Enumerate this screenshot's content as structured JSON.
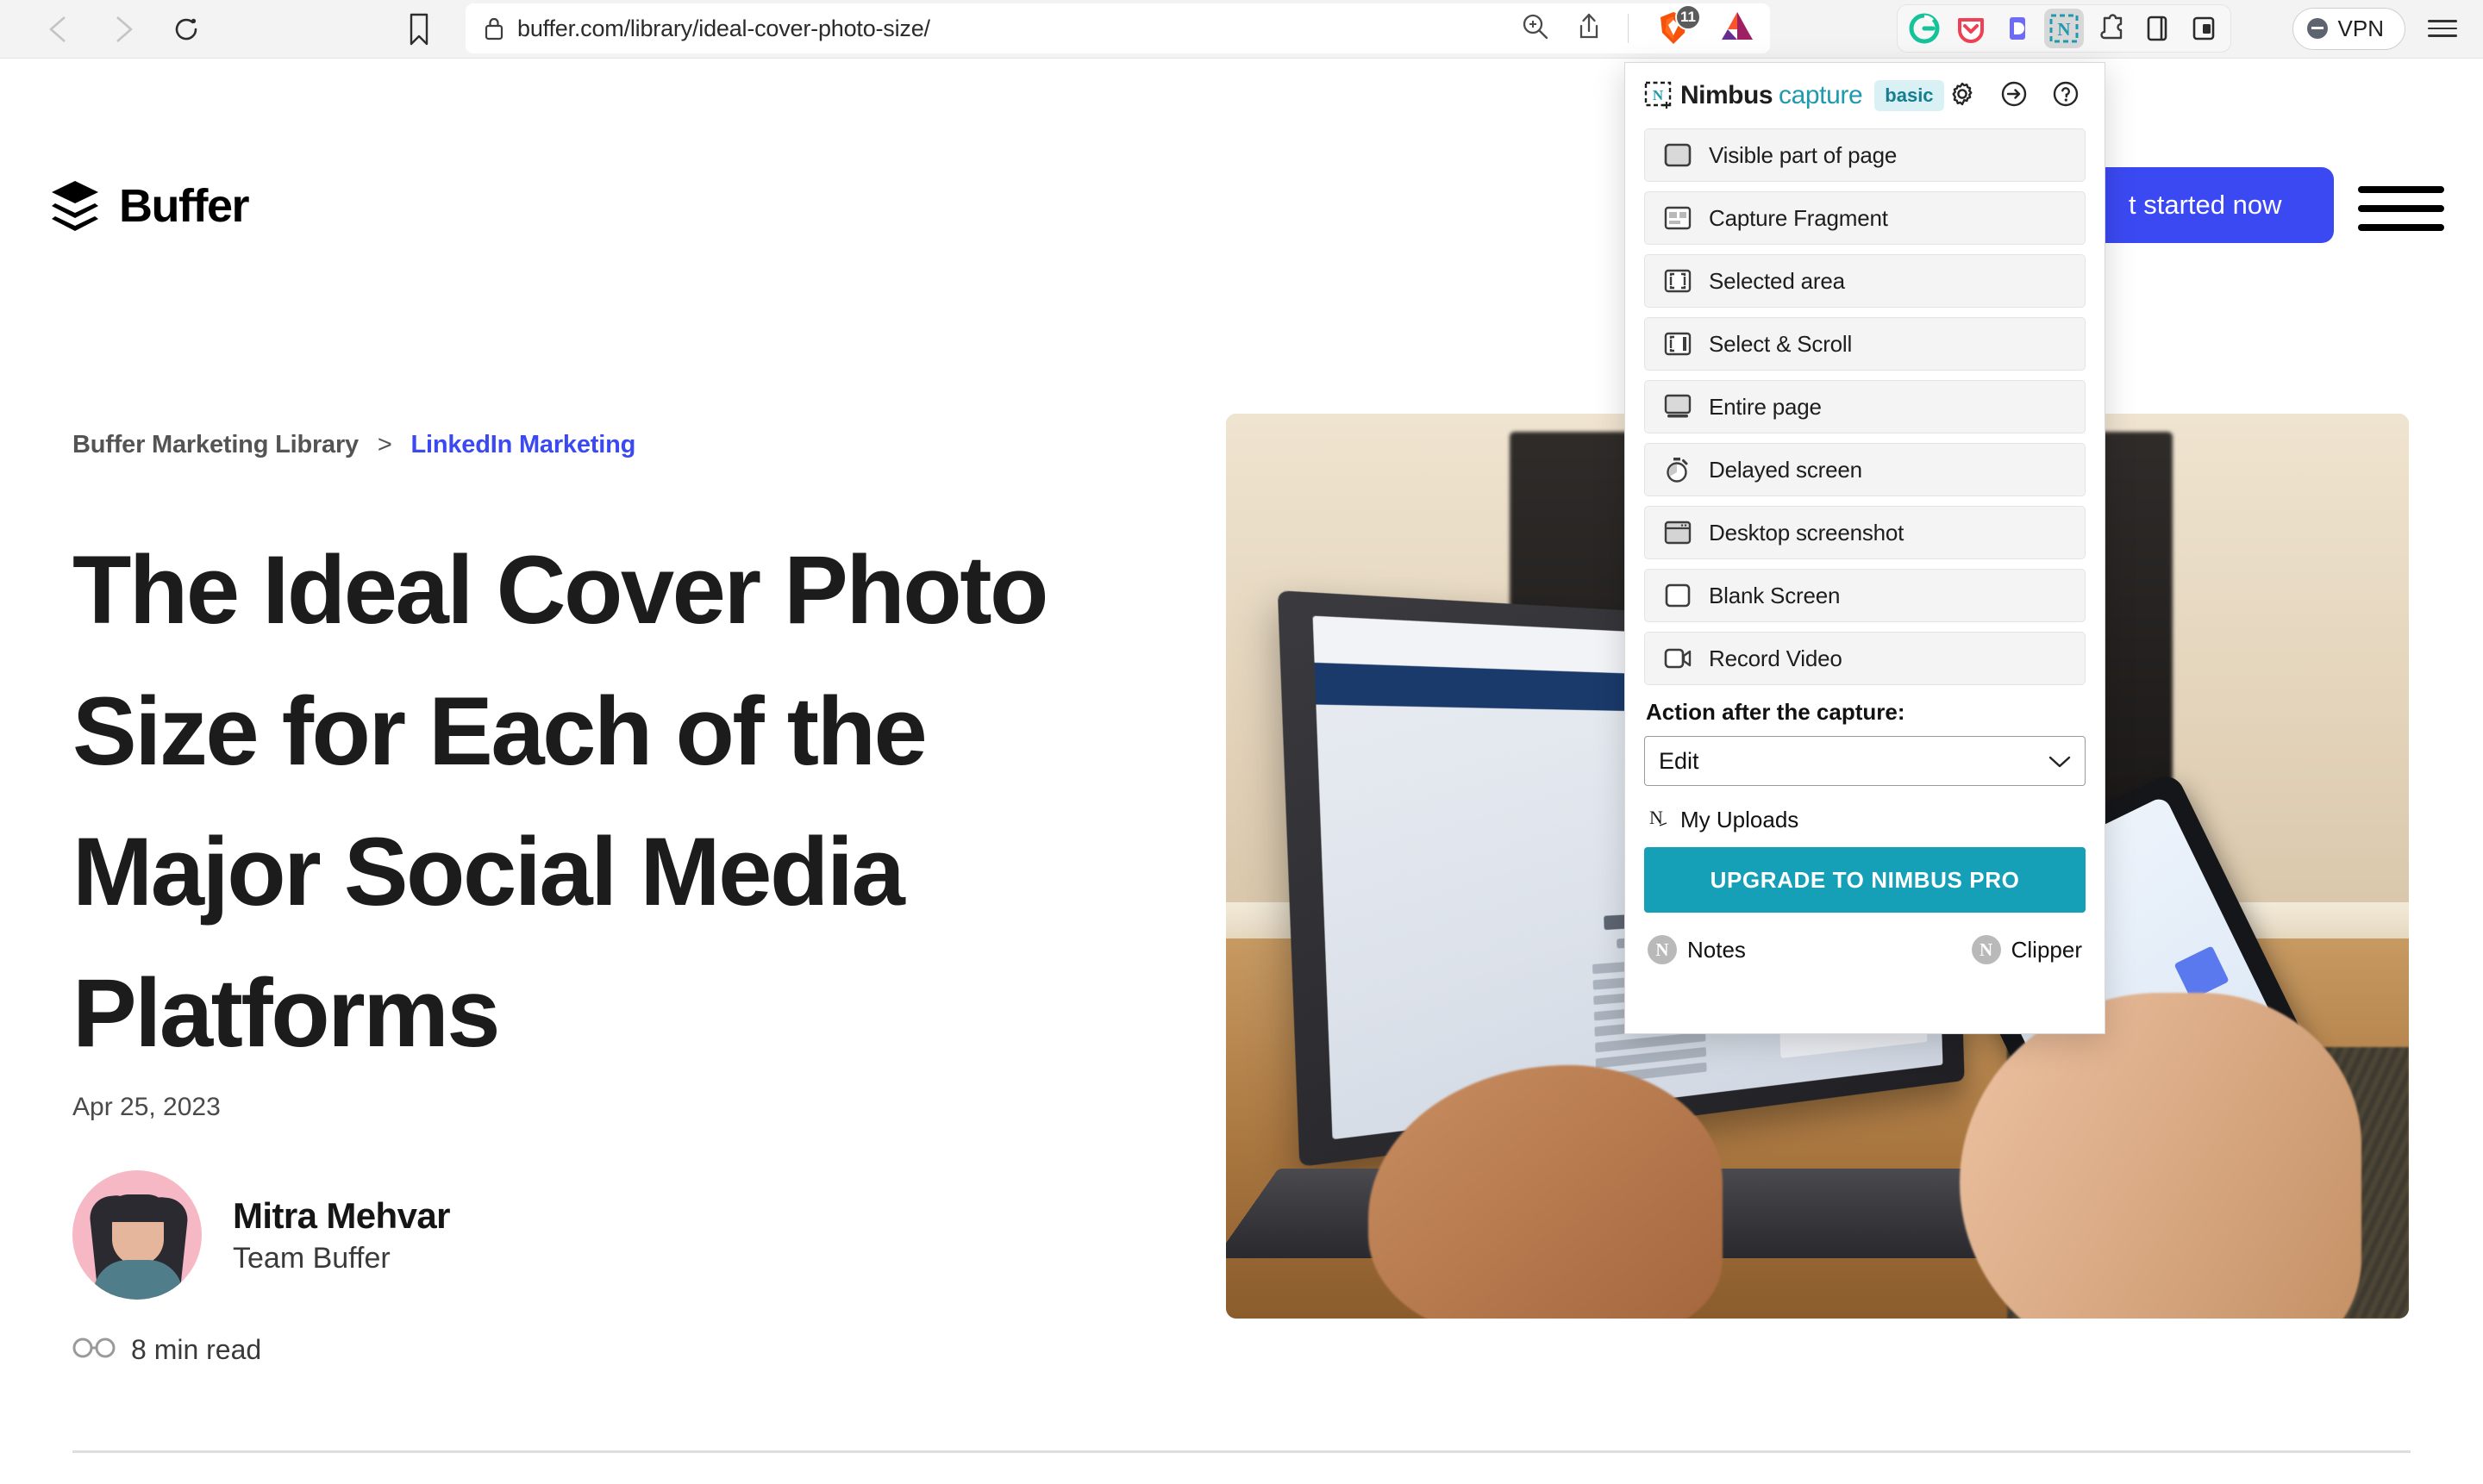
{
  "browser": {
    "back_icon": "back-arrow-icon",
    "forward_icon": "forward-arrow-icon",
    "reload_icon": "reload-icon",
    "bookmark_icon": "bookmark-icon",
    "lock_icon": "lock-icon",
    "url": "buffer.com/library/ideal-cover-photo-size/",
    "zoom_icon": "zoom-in-icon",
    "share_icon": "share-icon",
    "brave_shield_icon": "brave-shield-icon",
    "brave_shield_count": "11",
    "bat_rewards_icon": "bat-rewards-triangle-icon",
    "extensions": [
      {
        "name": "grammarly-extension-icon",
        "letter": "G",
        "color": "#15c39a",
        "active": false
      },
      {
        "name": "pocket-extension-icon",
        "letter": "",
        "color": "#ef4056",
        "active": false
      },
      {
        "name": "dashlane-extension-icon",
        "letter": "D",
        "color": "#6e6bf7",
        "active": false
      },
      {
        "name": "nimbus-capture-extension-icon",
        "letter": "N",
        "color": "#1e9ab0",
        "active": true
      },
      {
        "name": "puzzle-extensions-icon",
        "letter": "",
        "color": "#3c3c3c",
        "active": false
      },
      {
        "name": "sidebar-panel-icon",
        "letter": "",
        "color": "#3c3c3c",
        "active": false
      },
      {
        "name": "reading-list-icon",
        "letter": "",
        "color": "#3c3c3c",
        "active": false
      }
    ],
    "vpn_label": "VPN",
    "menu_icon": "hamburger-menu-icon"
  },
  "site": {
    "logo_text": "Buffer",
    "cta_label": "t started now",
    "menu_icon": "hamburger-menu-icon"
  },
  "article": {
    "breadcrumb_root": "Buffer Marketing Library",
    "breadcrumb_separator": ">",
    "breadcrumb_current": "LinkedIn Marketing",
    "title": "The Ideal Cover Photo Size for Each of the Major Social Media Platforms",
    "date": "Apr 25, 2023",
    "author_name": "Mitra Mehvar",
    "author_role": "Team Buffer",
    "read_time": "8 min read",
    "read_time_icon": "glasses-icon",
    "hero_image_alt": "laptop-with-facebook-page-and-hand-holding-phone"
  },
  "nimbus": {
    "brand_name": "Nimbus",
    "brand_accent": "capture",
    "plan_badge": "basic",
    "logo_icon": "nimbus-logo-icon",
    "header_actions": [
      {
        "name": "settings-gear-icon",
        "label": "gear-icon"
      },
      {
        "name": "sign-in-icon",
        "label": "arrow-right-circle-icon"
      },
      {
        "name": "help-icon",
        "label": "question-circle-icon"
      }
    ],
    "capture_items": [
      {
        "label": "Visible part of page",
        "icon": "visible-part-of-page-icon"
      },
      {
        "label": "Capture Fragment",
        "icon": "capture-fragment-icon"
      },
      {
        "label": "Selected area",
        "icon": "selected-area-icon"
      },
      {
        "label": "Select & Scroll",
        "icon": "select-and-scroll-icon"
      },
      {
        "label": "Entire page",
        "icon": "entire-page-icon"
      },
      {
        "label": "Delayed screen",
        "icon": "stopwatch-icon"
      },
      {
        "label": "Desktop screenshot",
        "icon": "desktop-screenshot-icon"
      },
      {
        "label": "Blank Screen",
        "icon": "blank-screen-icon"
      },
      {
        "label": "Record Video",
        "icon": "record-video-camera-icon"
      }
    ],
    "action_after_label": "Action after the capture:",
    "action_after_value": "Edit",
    "action_after_options": [
      "Edit"
    ],
    "my_uploads_label": "My Uploads",
    "my_uploads_icon": "nimbus-logo-icon",
    "upgrade_label": "UPGRADE TO NIMBUS PRO",
    "upgrade_color": "#15a0b8",
    "footer_left_label": "Notes",
    "footer_left_icon": "nimbus-notes-icon",
    "footer_right_label": "Clipper",
    "footer_right_icon": "nimbus-clipper-icon"
  }
}
